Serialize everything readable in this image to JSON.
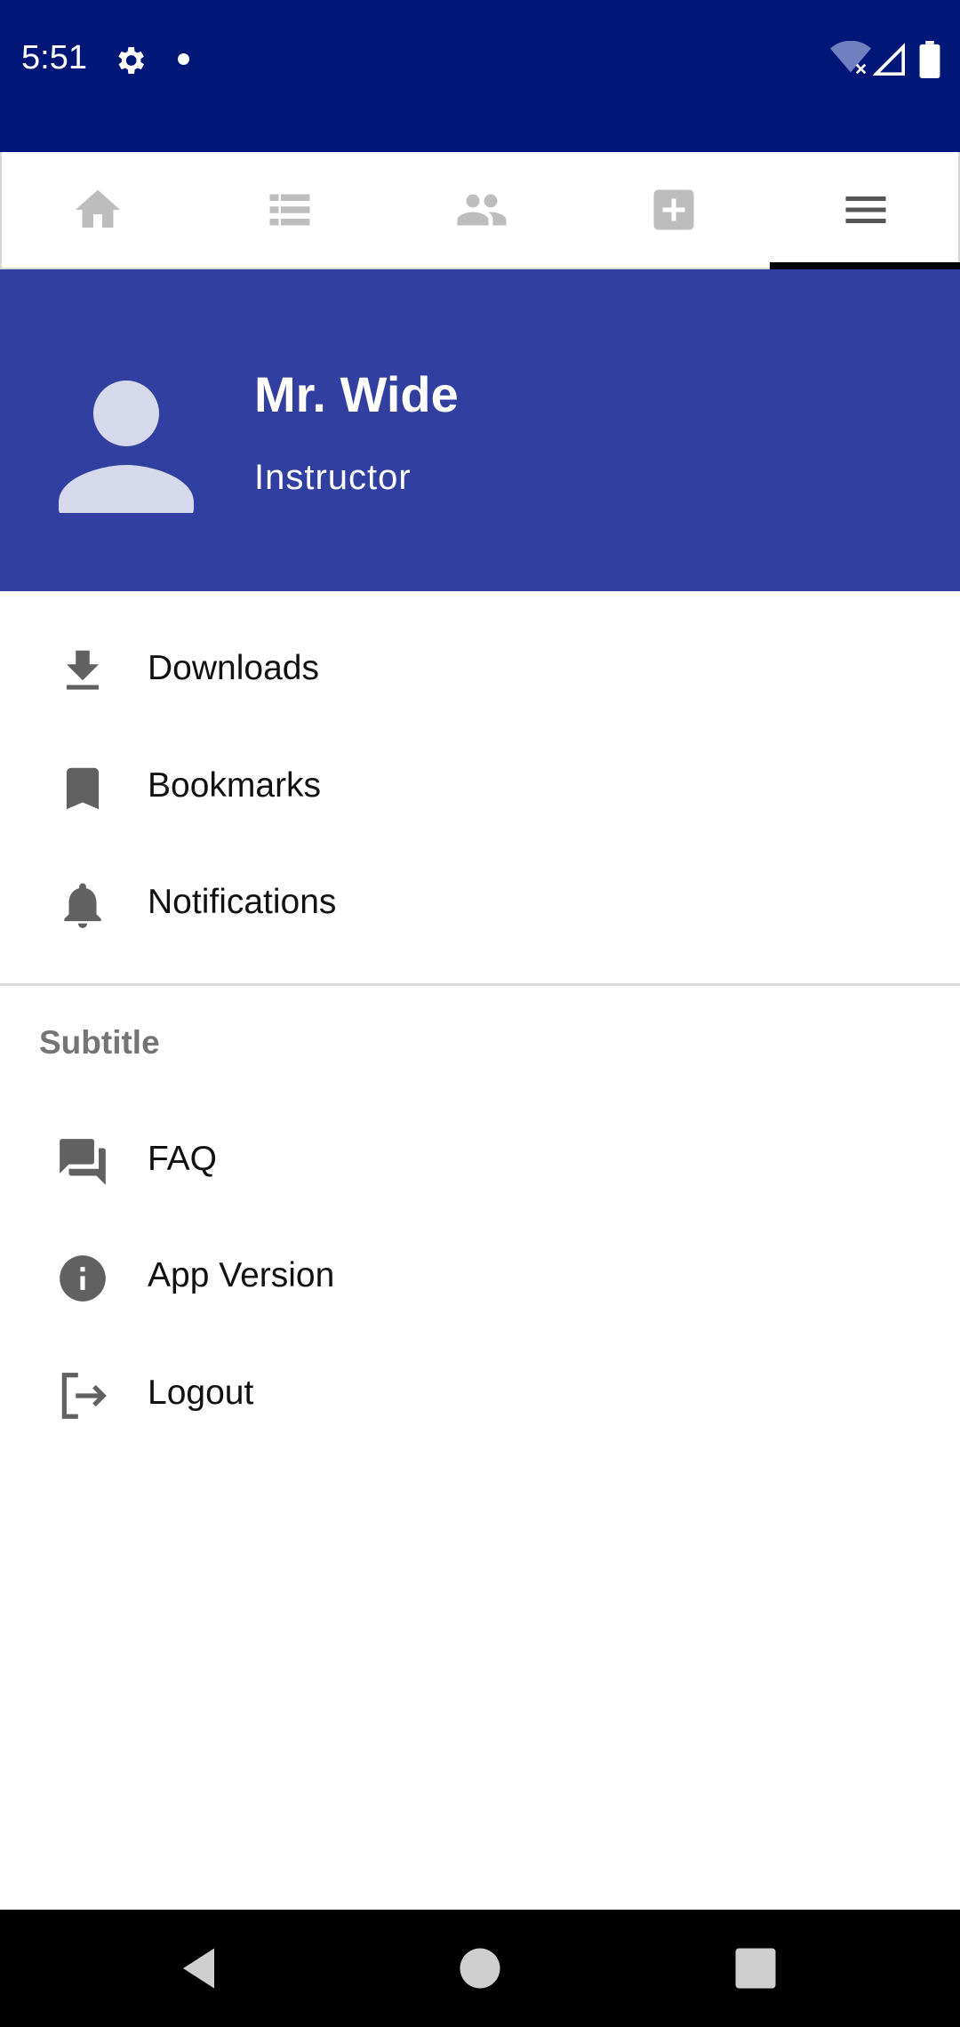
{
  "status_bar": {
    "time": "5:51",
    "icons": [
      "gear-icon",
      "dot-icon",
      "wifi-off-icon",
      "signal-icon",
      "battery-icon"
    ],
    "background": "#001777"
  },
  "tabs": [
    {
      "name": "home",
      "icon": "home-icon",
      "selected": false
    },
    {
      "name": "list",
      "icon": "list-icon",
      "selected": false
    },
    {
      "name": "people",
      "icon": "people-icon",
      "selected": false
    },
    {
      "name": "add",
      "icon": "add-box-icon",
      "selected": false
    },
    {
      "name": "menu",
      "icon": "menu-icon",
      "selected": true
    }
  ],
  "profile": {
    "name": "Mr. Wide",
    "role": "Instructor",
    "background": "#3140a0"
  },
  "menu": {
    "items": [
      {
        "label": "Downloads",
        "icon": "download-icon"
      },
      {
        "label": "Bookmarks",
        "icon": "bookmark-icon"
      },
      {
        "label": "Notifications",
        "icon": "bell-icon"
      }
    ],
    "subtitle": "Subtitle",
    "secondary_items": [
      {
        "label": "FAQ",
        "icon": "forum-icon"
      },
      {
        "label": "App Version",
        "icon": "info-icon"
      },
      {
        "label": "Logout",
        "icon": "logout-icon"
      }
    ]
  },
  "nav_bar": {
    "buttons": [
      "back-icon",
      "home-circle-icon",
      "recents-icon"
    ]
  }
}
